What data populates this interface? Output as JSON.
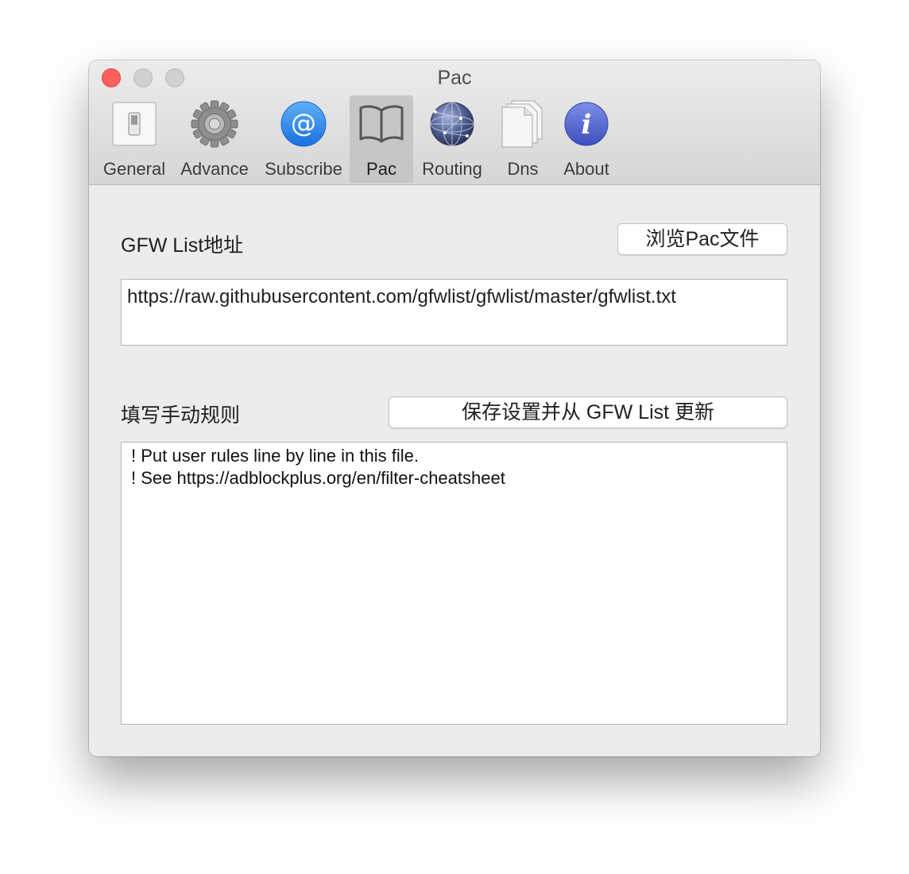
{
  "window": {
    "title": "Pac"
  },
  "toolbar": {
    "items": [
      {
        "label": "General",
        "icon": "switch-icon",
        "active": false
      },
      {
        "label": "Advance",
        "icon": "gear-icon",
        "active": false
      },
      {
        "label": "Subscribe",
        "icon": "at-sign-icon",
        "active": false
      },
      {
        "label": "Pac",
        "icon": "book-icon",
        "active": true
      },
      {
        "label": "Routing",
        "icon": "globe-network-icon",
        "active": false
      },
      {
        "label": "Dns",
        "icon": "documents-icon",
        "active": false
      },
      {
        "label": "About",
        "icon": "info-icon",
        "active": false
      }
    ]
  },
  "pac": {
    "gfw_list_label": "GFW List地址",
    "browse_button": "浏览Pac文件",
    "gfw_list_url": "https://raw.githubusercontent.com/gfwlist/gfwlist/master/gfwlist.txt",
    "manual_rules_label": "填写手动规则",
    "save_update_button": "保存设置并从 GFW List 更新",
    "user_rules": [
      "! Put user rules line by line in this file.",
      "! See https://adblockplus.org/en/filter-cheatsheet"
    ]
  },
  "colors": {
    "close": "#fc605c",
    "accent_blue": "#2f83ea",
    "window_bg": "#ececec"
  }
}
